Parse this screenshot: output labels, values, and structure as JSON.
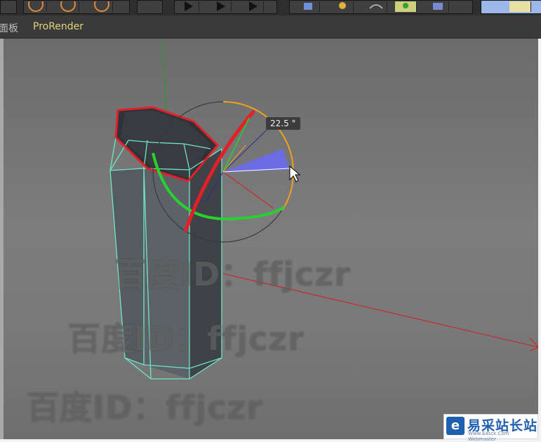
{
  "menubar": {
    "items": [
      "面板",
      "ProRender"
    ]
  },
  "viewport": {
    "rotation_readout": "22.5 °"
  },
  "watermarks": [
    "百度ID：ffjczr",
    "百度ID：ffjczr",
    "百度ID：ffjczr"
  ],
  "logo": {
    "title": "易采站长站",
    "subtitle": "Www.Easck.Com Webmaster",
    "icon_glyph": "e"
  },
  "colors": {
    "axis_x": "#d11f1f",
    "axis_y": "#1d9e2b",
    "axis_z": "#2a2a9a",
    "ring_orange": "#f0a020",
    "selection": "#e3202a",
    "mesh_edge": "#6fe6c6",
    "wedge": "#6a6af0",
    "menu_active": "#e5d37a"
  },
  "icons": [
    "toolbar-render-icons",
    "move-cursor-icon"
  ]
}
